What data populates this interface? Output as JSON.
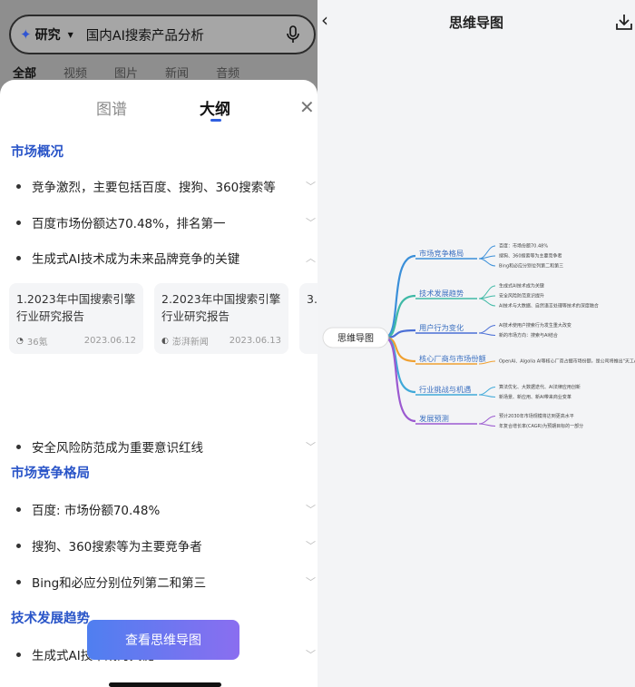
{
  "search": {
    "mode": "研究",
    "query": "国内AI搜索产品分析",
    "tabs": [
      "全部",
      "视频",
      "图片",
      "新闻",
      "音频"
    ]
  },
  "sheet": {
    "tabs": [
      "图谱",
      "大纲"
    ],
    "active_tab": "大纲",
    "sections": [
      {
        "title": "市场概况",
        "items": [
          "竞争激烈，主要包括百度、搜狗、360搜索等",
          "百度市场份额达70.48%，排名第一",
          "生成式AI技术成为未来品牌竞争的关键",
          "安全风险防范成为重要意识红线"
        ]
      },
      {
        "title": "市场竞争格局",
        "items": [
          "百度: 市场份额70.48%",
          "搜狗、360搜索等为主要竞争者",
          "Bing和必应分别位列第二和第三"
        ]
      },
      {
        "title": "技术发展趋势",
        "items": [
          "生成式AI技术成为关键"
        ]
      }
    ],
    "cards": [
      {
        "title": "1.2023年中国搜索引擎行业研究报告",
        "source": "36氪",
        "date": "2023.06.12"
      },
      {
        "title": "2.2023年中国搜索引擎行业研究报告",
        "source": "澎湃新闻",
        "date": "2023.06.13"
      },
      {
        "title": "3.",
        "source": "",
        "date": ""
      }
    ],
    "button": "查看思维导图"
  },
  "mindmap": {
    "title": "思维导图",
    "root": "思维导图",
    "branches": [
      {
        "label": "市场竞争格局",
        "color": "#3a8fd9",
        "leaves": [
          "百度：市场份额70.48%",
          "搜狗、360搜索等为主要竞争者",
          "Bing和必应分别位列第二和第三"
        ]
      },
      {
        "label": "技术发展趋势",
        "color": "#3fb9a6",
        "leaves": [
          "生成式AI技术成为关键",
          "安全风险防范意识提升",
          "AI技术与大数据、自然语言处理等技术的深度融合"
        ]
      },
      {
        "label": "用户行为变化",
        "color": "#4a6fd6",
        "leaves": [
          "AI技术使用户搜索行为发生重大改变",
          "新的市场方向：搜索与AI结合"
        ]
      },
      {
        "label": "核心厂商与市场份额",
        "color": "#f0a030",
        "leaves": [
          "OpenAI、Algolia AI等核心厂商占据市场份额，是公司将推出\"天工AI\"国内首款AI搜索引擎"
        ]
      },
      {
        "label": "行业挑战与机遇",
        "color": "#3fa9d9",
        "leaves": [
          "算法优化、大数据迭代、AI法律应用创新",
          "新场景、新应用、新AI带来商业变革"
        ]
      },
      {
        "label": "发展预测",
        "color": "#9b59d0",
        "leaves": [
          "预计2030年市场规模将达到更高水平",
          "年复合增长率(CAGR)为预期目标的一部分"
        ]
      }
    ]
  },
  "colors": {
    "accent": "#2a55c8",
    "tab_underline": "#2f5fe0",
    "button_start": "#4f7ff0",
    "button_end": "#8a6ef0"
  }
}
